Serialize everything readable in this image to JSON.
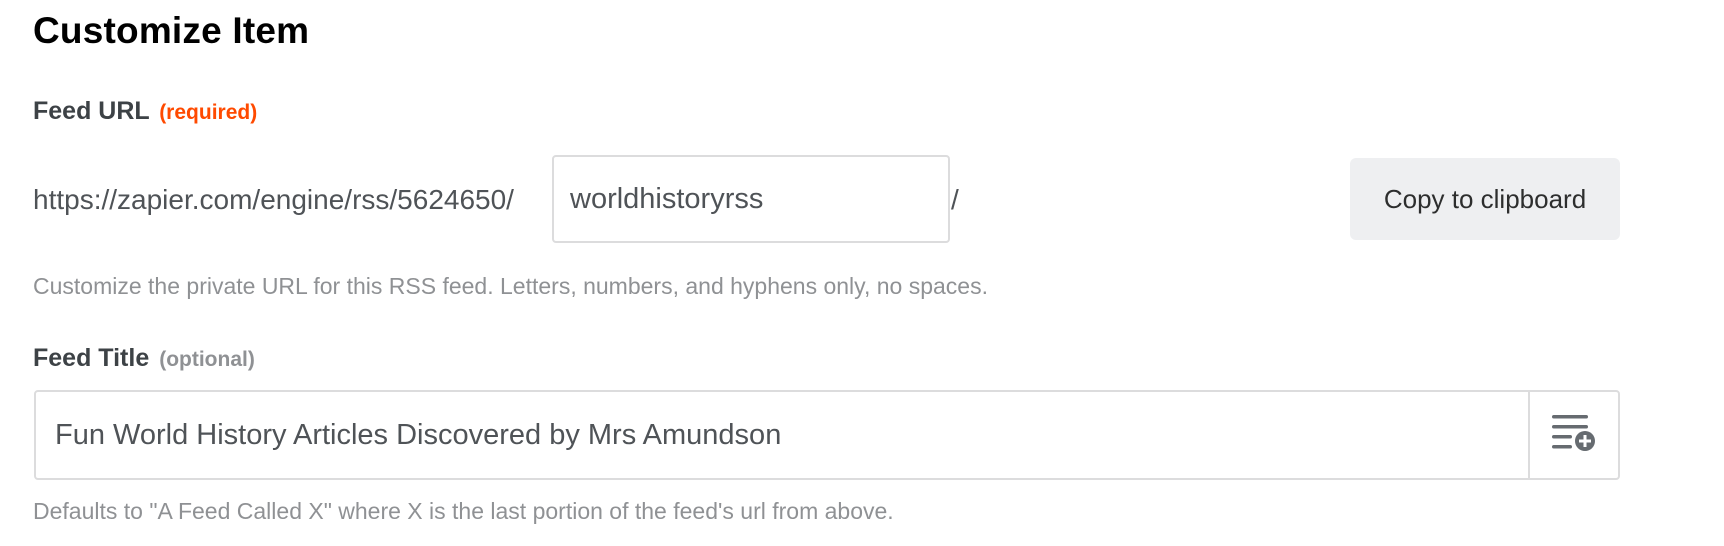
{
  "header": {
    "title": "Customize Item"
  },
  "feed_url": {
    "label": "Feed URL",
    "required_tag": "(required)",
    "prefix": "https://zapier.com/engine/rss/5624650/",
    "slug_value": "worldhistoryrss",
    "suffix": "/",
    "copy_button_label": "Copy to clipboard",
    "help_text": "Customize the private URL for this RSS feed. Letters, numbers, and hyphens only, no spaces."
  },
  "feed_title": {
    "label": "Feed Title",
    "optional_tag": "(optional)",
    "value": "Fun World History Articles Discovered by Mrs Amundson",
    "insert_icon": "insert-data-icon",
    "help_text": "Defaults to \"A Feed Called X\" where X is the last portion of the feed's url from above."
  },
  "colors": {
    "required_accent": "#ff4a00",
    "muted_text": "#8f9194",
    "border": "#dcdcdd",
    "button_bg": "#eeeff1"
  }
}
